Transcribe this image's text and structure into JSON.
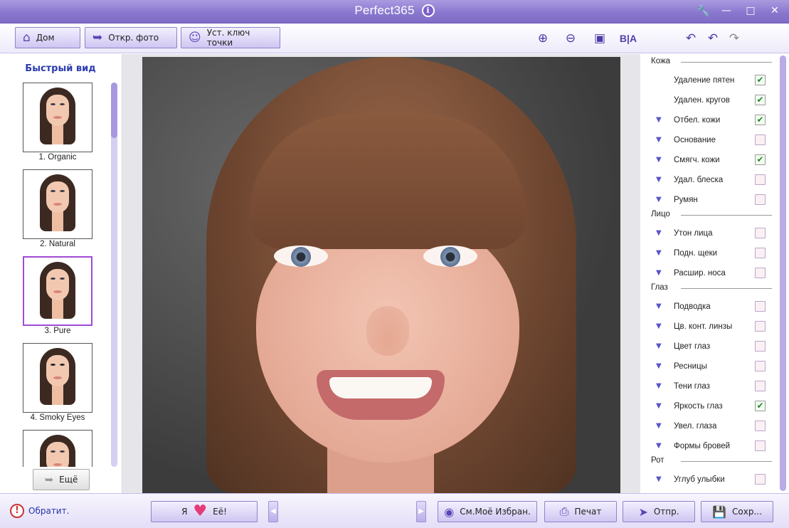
{
  "window": {
    "title": "Perfect365",
    "icons": [
      "info-icon",
      "wrench-icon",
      "minimize-icon",
      "maximize-icon",
      "close-icon"
    ]
  },
  "toolbar": {
    "home_label": "Дом",
    "open_label": "Откр. фото",
    "keypoints_label": "Уст. ключ точки",
    "ba_label": "B|A"
  },
  "quickview": {
    "title": "Быстрый вид",
    "items": [
      {
        "label": "1. Organic"
      },
      {
        "label": "2. Natural"
      },
      {
        "label": "3. Pure"
      },
      {
        "label": "4. Smoky Eyes"
      },
      {
        "label": ""
      }
    ],
    "selected_index": 2,
    "more_label": "Ещё"
  },
  "panel": {
    "sections": [
      {
        "title": "Кожа",
        "items": [
          {
            "label": "Удаление пятен",
            "expandable": false,
            "checked": true
          },
          {
            "label": "Удален. кругов",
            "expandable": false,
            "checked": true
          },
          {
            "label": "Отбел. кожи",
            "expandable": true,
            "checked": true
          },
          {
            "label": "Основание",
            "expandable": true,
            "checked": false
          },
          {
            "label": "Смягч. кожи",
            "expandable": true,
            "checked": true
          },
          {
            "label": "Удал. блеска",
            "expandable": true,
            "checked": false
          },
          {
            "label": "Румян",
            "expandable": true,
            "checked": false
          }
        ]
      },
      {
        "title": "Лицо",
        "items": [
          {
            "label": "Утон лица",
            "expandable": true,
            "checked": false
          },
          {
            "label": "Подн. щеки",
            "expandable": true,
            "checked": false
          },
          {
            "label": "Расшир. носа",
            "expandable": true,
            "checked": false
          }
        ]
      },
      {
        "title": "Глаз",
        "items": [
          {
            "label": "Подводка",
            "expandable": true,
            "checked": false
          },
          {
            "label": "Цв. конт. линзы",
            "expandable": true,
            "checked": false
          },
          {
            "label": "Цвет глаз",
            "expandable": true,
            "checked": false
          },
          {
            "label": "Ресницы",
            "expandable": true,
            "checked": false
          },
          {
            "label": "Тени глаз",
            "expandable": true,
            "checked": false
          },
          {
            "label": "Яркость глаз",
            "expandable": true,
            "checked": true
          },
          {
            "label": "Увел. глаза",
            "expandable": true,
            "checked": false
          },
          {
            "label": "Формы бровей",
            "expandable": true,
            "checked": false
          }
        ]
      },
      {
        "title": "Рот",
        "items": [
          {
            "label": "Углуб улыбки",
            "expandable": true,
            "checked": false
          }
        ]
      }
    ]
  },
  "bottombar": {
    "report_label": "Обратит.",
    "love_prefix": "Я",
    "love_suffix": "Её!",
    "favorites_label": "См.Моё Избран.",
    "print_label": "Печат",
    "send_label": "Отпр.",
    "save_label": "Сохр..."
  },
  "colors": {
    "titlebar": "#8a78cf",
    "accent": "#5a44b8",
    "selected_thumb": "#a24ad6",
    "check": "#1d8a2a"
  }
}
